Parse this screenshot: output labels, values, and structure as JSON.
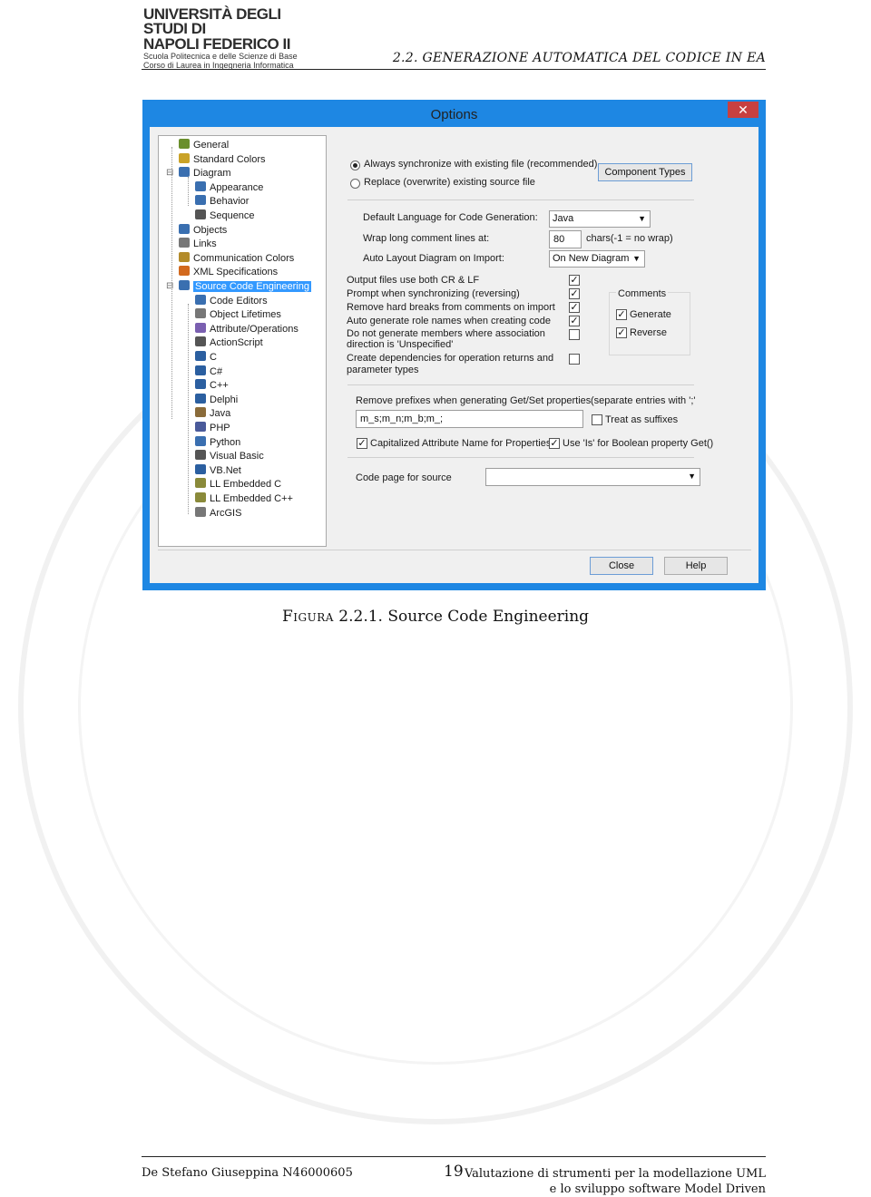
{
  "header": {
    "logo_line1": "UNIVERSITÀ DEGLI STUDI DI",
    "logo_line2": "NAPOLI FEDERICO II",
    "logo_line3": "Scuola Politecnica e delle Scienze di Base",
    "logo_line4": "Corso di Laurea in Ingegneria Informatica",
    "running_head": "2.2.  GENERAZIONE AUTOMATICA DEL CODICE IN EA"
  },
  "dialog": {
    "title": "Options",
    "close_glyph": "✕",
    "tree": [
      {
        "label": "General",
        "color": "#6a8f2c"
      },
      {
        "label": "Standard Colors",
        "color": "#c9a227"
      },
      {
        "label": "Diagram",
        "color": "#3a6fb0"
      },
      {
        "label": "Appearance",
        "color": "#3a6fb0"
      },
      {
        "label": "Behavior",
        "color": "#3a6fb0"
      },
      {
        "label": "Sequence",
        "color": "#555555"
      },
      {
        "label": "Objects",
        "color": "#3a6fb0"
      },
      {
        "label": "Links",
        "color": "#777777"
      },
      {
        "label": "Communication Colors",
        "color": "#b38b2a"
      },
      {
        "label": "XML Specifications",
        "color": "#d2691e"
      },
      {
        "label": "Source Code Engineering",
        "color": "#3a6fb0"
      },
      {
        "label": "Code Editors",
        "color": "#3a6fb0"
      },
      {
        "label": "Object Lifetimes",
        "color": "#777777"
      },
      {
        "label": "Attribute/Operations",
        "color": "#7a5fb0"
      },
      {
        "label": "ActionScript",
        "color": "#555555"
      },
      {
        "label": "C",
        "color": "#2b5fa0"
      },
      {
        "label": "C#",
        "color": "#2b5fa0"
      },
      {
        "label": "C++",
        "color": "#2b5fa0"
      },
      {
        "label": "Delphi",
        "color": "#2b5fa0"
      },
      {
        "label": "Java",
        "color": "#8a6b3a"
      },
      {
        "label": "PHP",
        "color": "#4a5a9a"
      },
      {
        "label": "Python",
        "color": "#3a6fb0"
      },
      {
        "label": "Visual Basic",
        "color": "#555555"
      },
      {
        "label": "VB.Net",
        "color": "#2b5fa0"
      },
      {
        "label": "LL Embedded C",
        "color": "#8a8a3a"
      },
      {
        "label": "LL Embedded C++",
        "color": "#8a8a3a"
      },
      {
        "label": "ArcGIS",
        "color": "#777777"
      }
    ],
    "selected_item": "Source Code Engineering",
    "radio_always": "Always synchronize with existing file (recommended)",
    "radio_replace": "Replace (overwrite) existing source file",
    "btn_component_types": "Component Types",
    "label_default_lang": "Default Language for Code Generation:",
    "value_default_lang": "Java",
    "label_wrap": "Wrap long comment lines at:",
    "value_wrap": "80",
    "wrap_hint": "chars(-1 = no wrap)",
    "label_auto_layout": "Auto Layout Diagram on Import:",
    "value_auto_layout": "On New Diagram",
    "opt_crlf": "Output files use both CR & LF",
    "opt_remove_breaks": "Prompt when synchronizing (reversing)",
    "opt_remove_hard": "Remove hard breaks from  comments on import",
    "opt_role_names": "Auto generate role names when creating code",
    "opt_no_members_1": "Do not generate members where association",
    "opt_no_members_2": "direction is 'Unspecified'",
    "opt_dependencies_1": "Create dependencies for operation returns and",
    "opt_dependencies_2": "parameter types",
    "comments_title": "Comments",
    "comments_generate": "Generate",
    "comments_reverse": "Reverse",
    "label_prefixes": "Remove prefixes when generating Get/Set properties",
    "prefixes_hint": "(separate entries with ';'",
    "value_prefixes": "m_s;m_n;m_b;m_;",
    "opt_suffixes": "Treat as suffixes",
    "opt_capitalized": "Capitalized Attribute Name for Properties",
    "opt_use_is": "Use 'Is' for Boolean property Get()",
    "label_code_page": "Code page for source",
    "value_code_page": "",
    "btn_close": "Close",
    "btn_help": "Help"
  },
  "caption": {
    "prefix": "Figura",
    "text": " 2.2.1.  Source Code Engineering"
  },
  "footer": {
    "author": "De Stefano Giuseppina N46000605",
    "page": "19",
    "right_line1": "Valutazione di strumenti per la modellazione UML",
    "right_line2": "e lo sviluppo software Model Driven"
  }
}
